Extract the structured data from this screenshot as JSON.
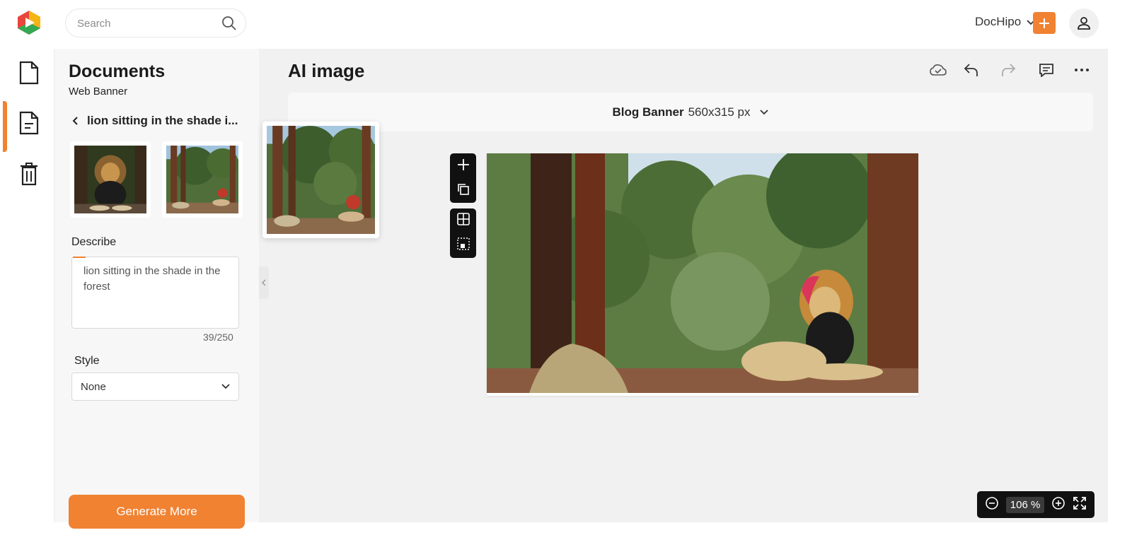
{
  "header": {
    "search_placeholder": "Search",
    "brand_label": "DocHipo"
  },
  "rail": {
    "items": [
      "file-icon",
      "document-icon",
      "trash-icon"
    ],
    "active_index": 1
  },
  "panel": {
    "title": "Documents",
    "subtitle": "Web Banner",
    "prompt_title": "lion sitting in the shade i...",
    "describe_label": "Describe",
    "describe_value": "lion sitting in the shade in the forest",
    "counter": "39/250",
    "style_label": "Style",
    "style_value": "None",
    "generate_label": "Generate More"
  },
  "main": {
    "title": "AI image",
    "size_name": "Blog Banner",
    "size_dims": "560x315 px",
    "zoom": "106 %"
  },
  "colors": {
    "accent": "#f08232",
    "dark": "#111111"
  }
}
